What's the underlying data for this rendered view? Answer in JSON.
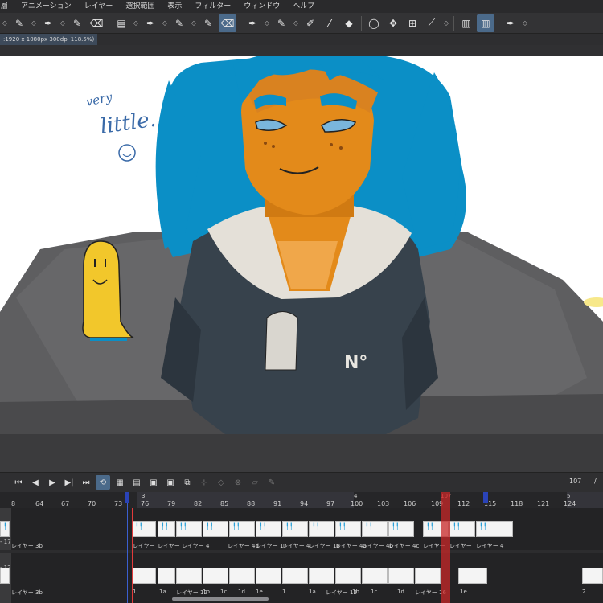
{
  "menu": [
    "層",
    "アニメーション",
    "レイヤー",
    "選択範囲",
    "表示",
    "フィルター",
    "ウィンドウ",
    "ヘルプ"
  ],
  "document": {
    "tab_label": ":1920 x 1080px 300dpi 118.5%)"
  },
  "toolbar": {
    "icons": [
      "pencil-icon",
      "pen-icon",
      "brush-icon",
      "eraser-icon",
      "folder-icon",
      "pen-icon",
      "pen-icon",
      "pen-icon",
      "pen-icon",
      "pen-icon",
      "marker-icon",
      "eyedropper-icon",
      "fill-icon",
      "lasso-icon",
      "move-icon",
      "transform-icon",
      "eyedropper-icon",
      "layer-panel-icon",
      "layer-panel-icon",
      "pen-icon"
    ]
  },
  "canvas": {
    "handwriting_line1": "very",
    "handwriting_line2": "little...",
    "badge_text": "N°",
    "colors": {
      "hair": "#0b8fc6",
      "skin": "#e38a1a",
      "uniform": "#37424c",
      "collar": "#e4e0d8",
      "ghost": "#f2c72b"
    }
  },
  "timeline": {
    "current_frame": "107",
    "frame_separator": "/",
    "ruler_top": [
      "3",
      "4",
      "107",
      "5"
    ],
    "ruler_numbers": [
      "8",
      "64",
      "67",
      "70",
      "73",
      "76",
      "79",
      "82",
      "85",
      "88",
      "91",
      "94",
      "97",
      "100",
      "103",
      "106",
      "109",
      "112",
      "115",
      "118",
      "121",
      "124"
    ],
    "track1": {
      "layer_name": "レイヤー 3b",
      "side_label": "- 17",
      "cell_labels": [
        "レイヤー",
        "レイヤー",
        "レイヤー 4",
        "レイヤー 4d",
        "レイヤー 17",
        "レイヤー 4",
        "レイヤー 18",
        "レイヤー 4a",
        "レイヤー 4b",
        "レイヤー 4c",
        "レイヤー",
        "レイヤー",
        "レイヤー 4"
      ]
    },
    "track2": {
      "layer_name": "レイヤー 3b",
      "side_label": "- 12",
      "cell_labels": [
        "1",
        "1a",
        "レイヤー 12",
        "1b",
        "1c",
        "1d",
        "1e",
        "1",
        "1a",
        "レイヤー 12",
        "1b",
        "1c",
        "1d",
        "レイヤー 16",
        "1e",
        "2"
      ]
    }
  }
}
